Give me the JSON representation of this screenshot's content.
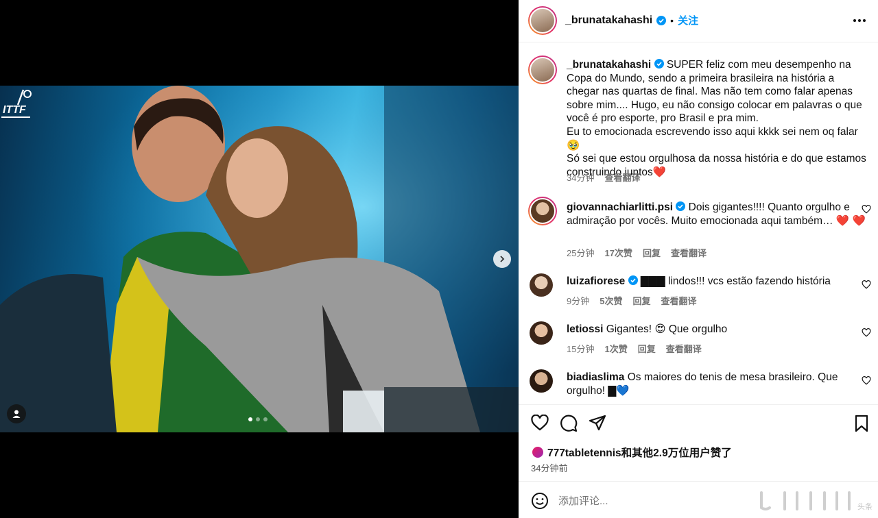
{
  "post": {
    "author": "_brunatakahashi",
    "follow_label": "关注",
    "carousel": {
      "active_index": 0,
      "count": 3
    }
  },
  "caption": {
    "username": "_brunatakahashi",
    "text": "SUPER feliz com meu desempenho na Copa do Mundo, sendo a primeira brasileira na história a chegar nas quartas de final. Mas não tem como falar apenas sobre mim.... Hugo, eu não consigo colocar em palavras o que você é pro esporte, pro Brasil e pra mim.\nEu to emocionada escrevendo isso aqui kkkk sei nem oq falar🥹\nSó sei que estou orgulhosa da nossa história e do que estamos construindo juntos❤️",
    "time": "34分钟",
    "translate": "查看翻译"
  },
  "comments": [
    {
      "username": "giovannachiarlitti.psi",
      "verified": true,
      "text": "Dois gigantes!!!! Quanto orgulho e admiração por vocês. Muito emocionada aqui também… ❤️ ❤️",
      "time": "25分钟",
      "likes": "17次赞",
      "reply": "回复",
      "translate": "查看翻译"
    },
    {
      "username": "luizafiorese",
      "verified": true,
      "text": "▇▇▇ lindos!!! vcs estão fazendo história",
      "time": "9分钟",
      "likes": "5次赞",
      "reply": "回复",
      "translate": "查看翻译"
    },
    {
      "username": "letiossi",
      "verified": false,
      "text": "Gigantes! 😍 Que orgulho",
      "time": "15分钟",
      "likes": "1次赞",
      "reply": "回复",
      "translate": "查看翻译"
    },
    {
      "username": "biadiaslima",
      "verified": false,
      "text": "Os maiores do tenis de mesa brasileiro. Que orgulho! ▇💙",
      "time": "",
      "likes": "",
      "reply": "",
      "translate": ""
    }
  ],
  "likes_summary": "777tabletennis和其他2.9万位用户赞了",
  "posted_time": "34分钟前",
  "add_comment_placeholder": "添加评论...",
  "watermark_text": "头条",
  "colors": {
    "accent": "#0095f6",
    "verified": "#0095f6",
    "muted": "#737373"
  },
  "icons": [
    "more-icon",
    "heart-icon",
    "comment-icon",
    "share-icon",
    "bookmark-icon",
    "emoji-icon",
    "verified-icon",
    "chevron-right-icon",
    "user-tag-icon"
  ]
}
